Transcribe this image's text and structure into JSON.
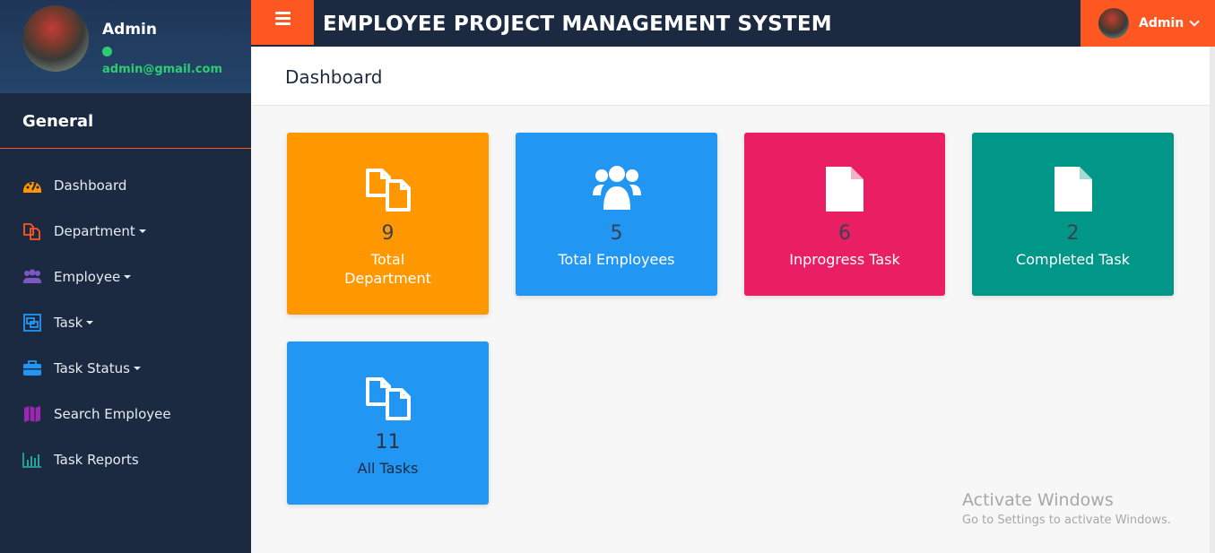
{
  "profile": {
    "name": "Admin",
    "email": "admin@gmail.com",
    "status_color": "#2ecc71"
  },
  "sidebar": {
    "section_title": "General",
    "items": [
      {
        "label": "Dashboard",
        "icon": "dashboard-icon",
        "dropdown": false
      },
      {
        "label": "Department",
        "icon": "copy-icon",
        "dropdown": true
      },
      {
        "label": "Employee",
        "icon": "users-icon",
        "dropdown": true
      },
      {
        "label": "Task",
        "icon": "object-group-icon",
        "dropdown": true
      },
      {
        "label": "Task Status",
        "icon": "briefcase-icon",
        "dropdown": true
      },
      {
        "label": "Search Employee",
        "icon": "map-icon",
        "dropdown": false
      },
      {
        "label": "Task Reports",
        "icon": "bar-chart-icon",
        "dropdown": false
      }
    ]
  },
  "topbar": {
    "title": "EMPLOYEE PROJECT MANAGEMENT SYSTEM",
    "user_label": "Admin",
    "accent_color": "#ff5722",
    "bg_color": "#1b2a41"
  },
  "page": {
    "title": "Dashboard"
  },
  "cards": [
    {
      "value": "9",
      "label_line1": "Total",
      "label_line2": "Department",
      "color": "#ff9800",
      "icon": "copy-icon"
    },
    {
      "value": "5",
      "label_line1": "Total Employees",
      "label_line2": "",
      "color": "#2196f3",
      "icon": "users-icon"
    },
    {
      "value": "6",
      "label_line1": "Inprogress Task",
      "label_line2": "",
      "color": "#e91e63",
      "icon": "file-icon"
    },
    {
      "value": "2",
      "label_line1": "Completed Task",
      "label_line2": "",
      "color": "#009688",
      "icon": "file-icon"
    },
    {
      "value": "11",
      "label_line1": "All Tasks",
      "label_line2": "",
      "color": "#2196f3",
      "icon": "copy-icon"
    }
  ],
  "watermark": {
    "line1": "Activate Windows",
    "line2": "Go to Settings to activate Windows."
  }
}
